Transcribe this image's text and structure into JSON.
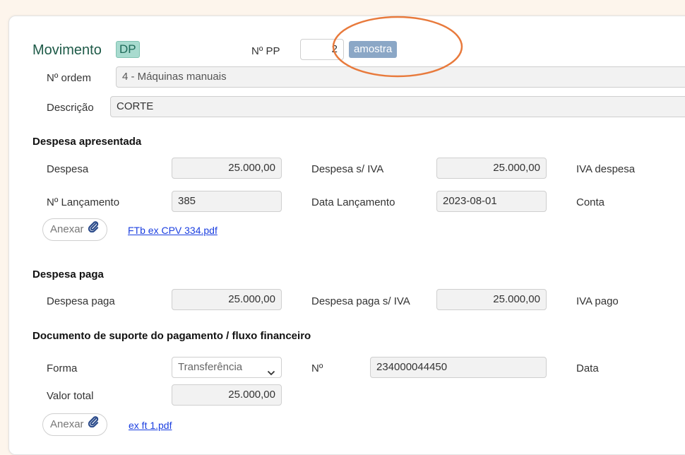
{
  "header": {
    "title": "Movimento",
    "type_badge": "DP",
    "pp_label": "Nº PP",
    "pp_value": "2",
    "sample_badge": "amostra",
    "ordem_label": "Nº ordem",
    "ordem_value": "4 - Máquinas manuais",
    "descricao_label": "Descrição",
    "descricao_value": "CORTE"
  },
  "despesa_apresentada": {
    "heading": "Despesa apresentada",
    "despesa_label": "Despesa",
    "despesa_value": "25.000,00",
    "despesa_siva_label": "Despesa s/ IVA",
    "despesa_siva_value": "25.000,00",
    "iva_label": "IVA despesa",
    "lancamento_label": "Nº Lançamento",
    "lancamento_value": "385",
    "data_label": "Data Lançamento",
    "data_value": "2023-08-01",
    "conta_label": "Conta",
    "anexar_label": "Anexar",
    "file_link": "FTb ex CPV 334.pdf"
  },
  "despesa_paga": {
    "heading": "Despesa paga",
    "paga_label": "Despesa paga",
    "paga_value": "25.000,00",
    "paga_siva_label": "Despesa paga s/ IVA",
    "paga_siva_value": "25.000,00",
    "iva_pago_label": "IVA pago"
  },
  "pagamento": {
    "heading": "Documento de suporte do pagamento / fluxo financeiro",
    "forma_label": "Forma",
    "forma_value": "Transferência",
    "numero_label": "Nº",
    "numero_value": "234000044450",
    "data_label": "Data",
    "valor_label": "Valor total",
    "valor_value": "25.000,00",
    "anexar_label": "Anexar",
    "file_link": "ex ft 1.pdf"
  },
  "colors": {
    "annotation_ellipse": "#e87a3c",
    "badge_dp_bg": "#a8dbcf",
    "badge_amostra_bg": "#8ba7c6",
    "link": "#1a3ee0"
  },
  "icons": {
    "anexar": "paperclip-icon",
    "select": "chevron-down-icon"
  }
}
